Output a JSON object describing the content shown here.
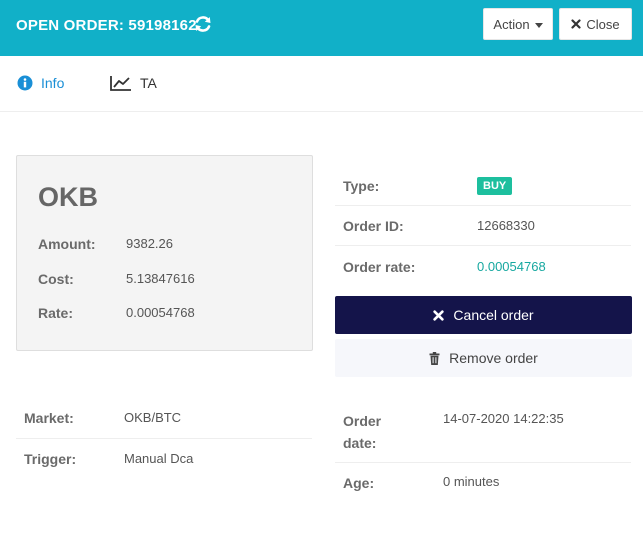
{
  "header": {
    "title": "OPEN ORDER: 59198162",
    "action_label": "Action",
    "close_label": "Close",
    "bg_color": "#11b0c8"
  },
  "tabs": [
    {
      "label": "Info",
      "icon": "info-circle-icon",
      "active": true
    },
    {
      "label": "TA",
      "icon": "line-chart-icon",
      "active": false
    }
  ],
  "summary": {
    "coin": "OKB",
    "amount_label": "Amount:",
    "amount": "9382.26",
    "cost_label": "Cost:",
    "cost": "5.13847616",
    "rate_label": "Rate:",
    "rate": "0.00054768"
  },
  "details": {
    "type_label": "Type:",
    "type": "BUY",
    "order_id_label": "Order ID:",
    "order_id": "12668330",
    "order_rate_label": "Order rate:",
    "order_rate": "0.00054768"
  },
  "actions": {
    "cancel_label": "Cancel order",
    "remove_label": "Remove order"
  },
  "market": {
    "market_label": "Market:",
    "market": "OKB/BTC",
    "trigger_label": "Trigger:",
    "trigger": "Manual Dca",
    "order_date_label_1": "Order",
    "order_date_label_2": "date:",
    "order_date": "14-07-2020 14:22:35",
    "age_label": "Age:",
    "age": "0 minutes"
  },
  "colors": {
    "accent": "#11b0c8",
    "buy_badge": "#1dbf9e",
    "cancel_btn": "#14144a",
    "link": "#1a8fd6",
    "rate_value": "#17a8a0"
  }
}
